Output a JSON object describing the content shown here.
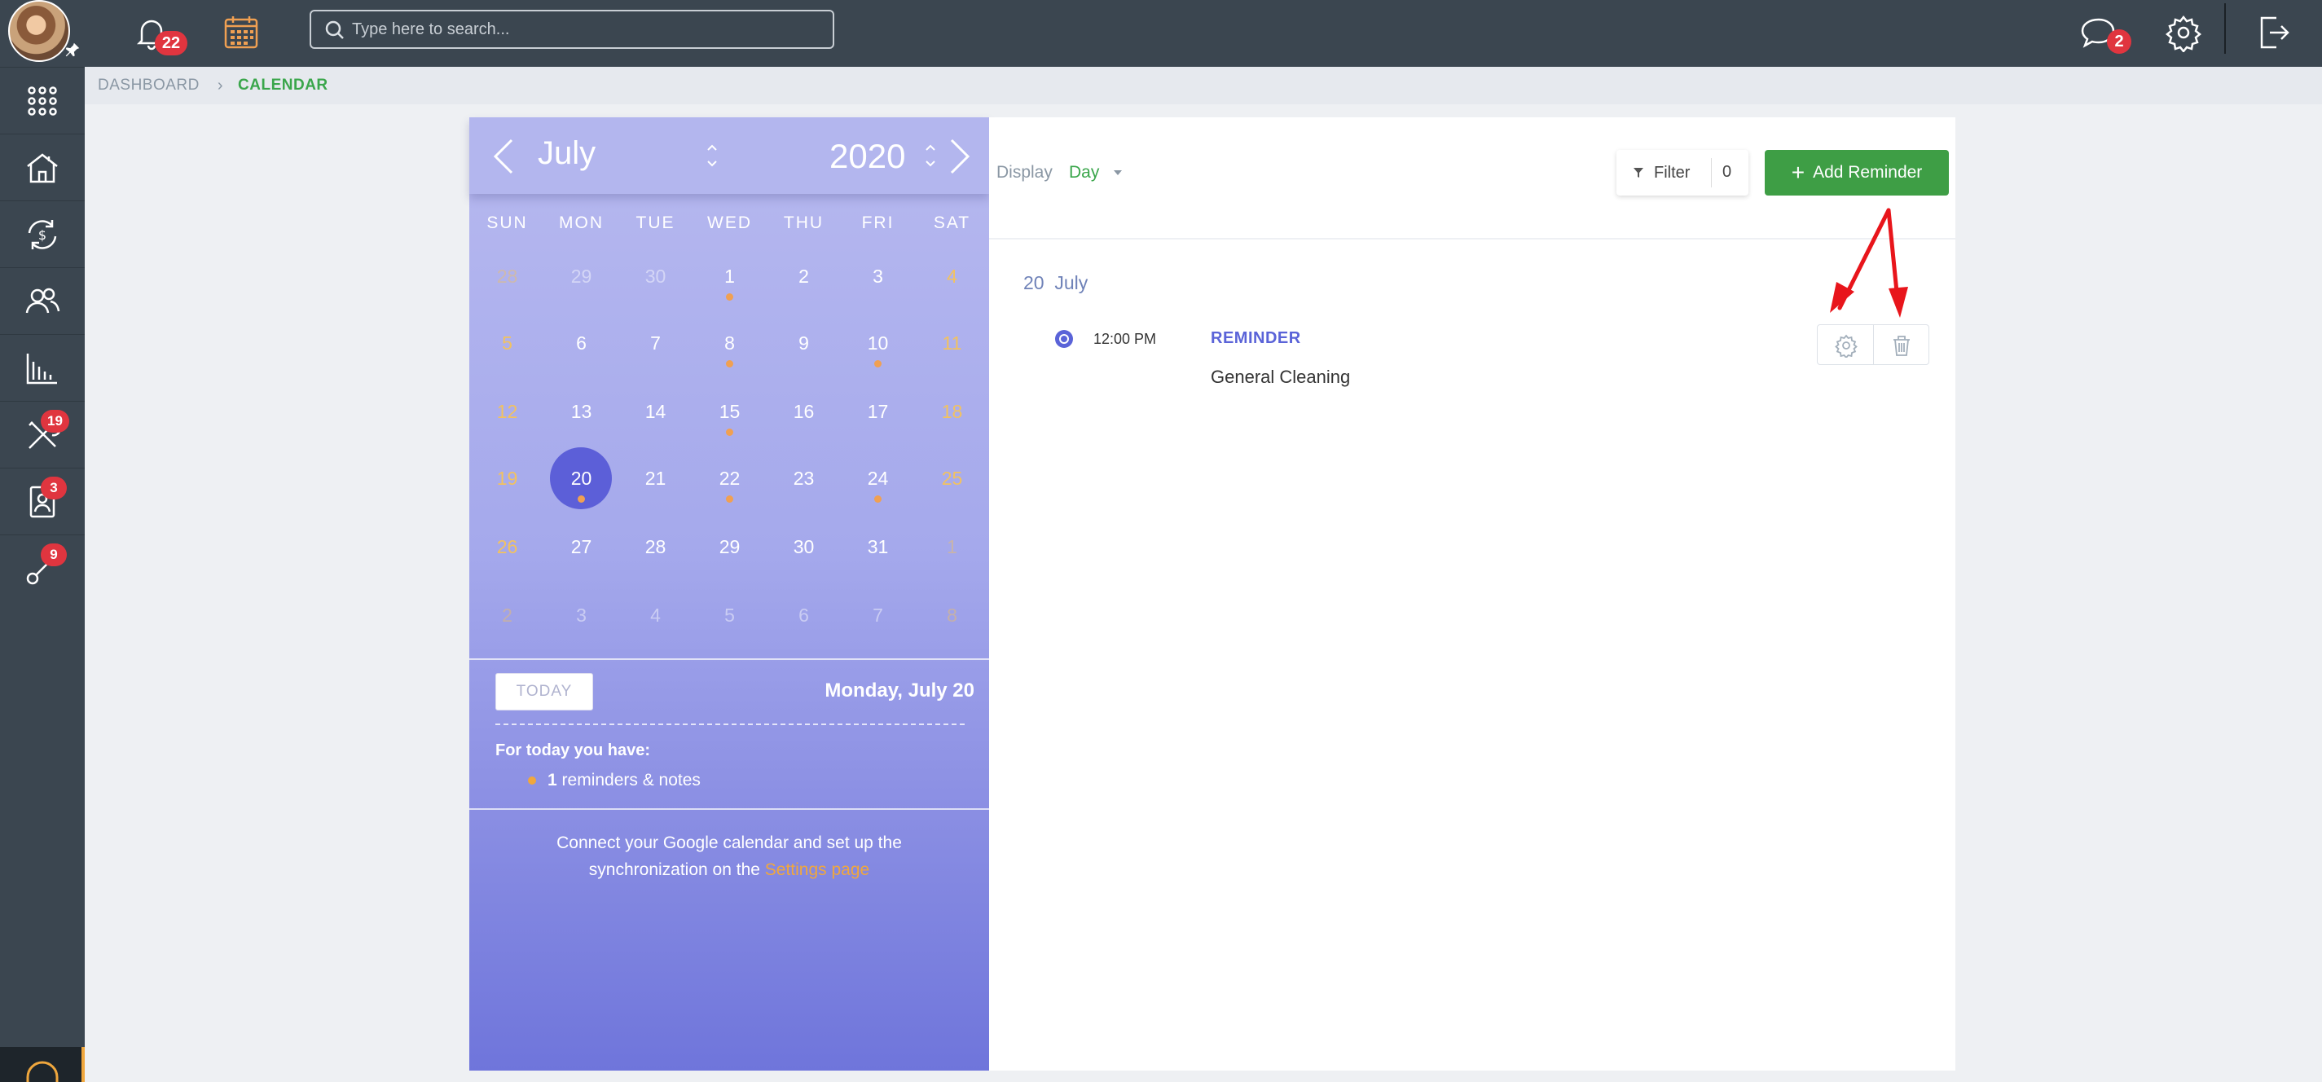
{
  "topbar": {
    "notifications_count": "22",
    "search_placeholder": "Type here to search...",
    "messages_count": "2"
  },
  "sidebar": {
    "items": [
      {
        "icon": "grid-icon"
      },
      {
        "icon": "house-icon"
      },
      {
        "icon": "money-cycle-icon"
      },
      {
        "icon": "contacts-icon"
      },
      {
        "icon": "bar-chart-icon"
      },
      {
        "icon": "tools-icon",
        "badge": "19"
      },
      {
        "icon": "contact-card-icon",
        "badge": "3"
      },
      {
        "icon": "keys-icon",
        "badge": "9"
      }
    ]
  },
  "breadcrumb": {
    "root": "DASHBOARD",
    "current": "CALENDAR"
  },
  "calendar": {
    "month": "July",
    "year": "2020",
    "weekdays": [
      "SUN",
      "MON",
      "TUE",
      "WED",
      "THU",
      "FRI",
      "SAT"
    ],
    "weeks": [
      [
        "28",
        "29",
        "30",
        "1",
        "2",
        "3",
        "4"
      ],
      [
        "5",
        "6",
        "7",
        "8",
        "9",
        "10",
        "11"
      ],
      [
        "12",
        "13",
        "14",
        "15",
        "16",
        "17",
        "18"
      ],
      [
        "19",
        "20",
        "21",
        "22",
        "23",
        "24",
        "25"
      ],
      [
        "26",
        "27",
        "28",
        "29",
        "30",
        "31",
        "1"
      ],
      [
        "2",
        "3",
        "4",
        "5",
        "6",
        "7",
        "8"
      ]
    ],
    "today_button": "TODAY",
    "today_date": "Monday, July 20",
    "for_today_label": "For today you have:",
    "reminders_count": "1",
    "reminders_label": " reminders & notes",
    "connect_text": "Connect your Google calendar and set up the synchronization on the ",
    "settings_link": "Settings page"
  },
  "content": {
    "display_label": "Display",
    "display_value": "Day",
    "filter_label": "Filter",
    "filter_count": "0",
    "add_button": "Add Reminder",
    "day_heading": "20  July",
    "events": [
      {
        "time": "12:00 PM",
        "type": "REMINDER",
        "title": "General Cleaning"
      }
    ]
  },
  "colors": {
    "sidebar_bg": "#3b4650",
    "accent_green": "#3e9e45",
    "badge_red": "#e0353f",
    "calendar_purple": "#8d91e4",
    "weekend_orange": "#f2c260"
  }
}
